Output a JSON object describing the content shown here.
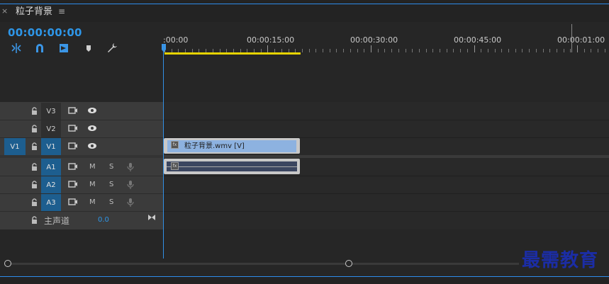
{
  "panel": {
    "title": "粒子背景",
    "close_glyph": "×",
    "menu_glyph": "≡"
  },
  "timecode": "00:00:00:00",
  "toolbar": [
    {
      "name": "snap-insert-icon"
    },
    {
      "name": "magnet-snap-icon"
    },
    {
      "name": "linked-selection-icon"
    },
    {
      "name": "add-marker-icon"
    },
    {
      "name": "wrench-settings-icon"
    }
  ],
  "ruler": {
    "labels": [
      ":00:00",
      "00:00:15:00",
      "00:00:30:00",
      "00:00:45:00",
      "00:00:01:00"
    ]
  },
  "video_tracks": [
    {
      "id": "V3",
      "source": "",
      "label": "V3"
    },
    {
      "id": "V2",
      "source": "",
      "label": "V2"
    },
    {
      "id": "V1",
      "source": "V1",
      "label": "V1"
    }
  ],
  "audio_tracks": [
    {
      "label": "A1",
      "mute": "M",
      "solo": "S"
    },
    {
      "label": "A2",
      "mute": "M",
      "solo": "S"
    },
    {
      "label": "A3",
      "mute": "M",
      "solo": "S"
    }
  ],
  "master": {
    "label": "主声道",
    "value": "0.0"
  },
  "clips": {
    "video_clip_label": "粒子背景.wmv [V]",
    "fx_glyph": "fx"
  },
  "watermark": "最需教育",
  "colors": {
    "accent": "#2e96e8",
    "work_area": "#e6d300",
    "clip_video": "#8db2e0",
    "clip_audio": "#3b4660",
    "track_target": "#1d5e8f"
  }
}
